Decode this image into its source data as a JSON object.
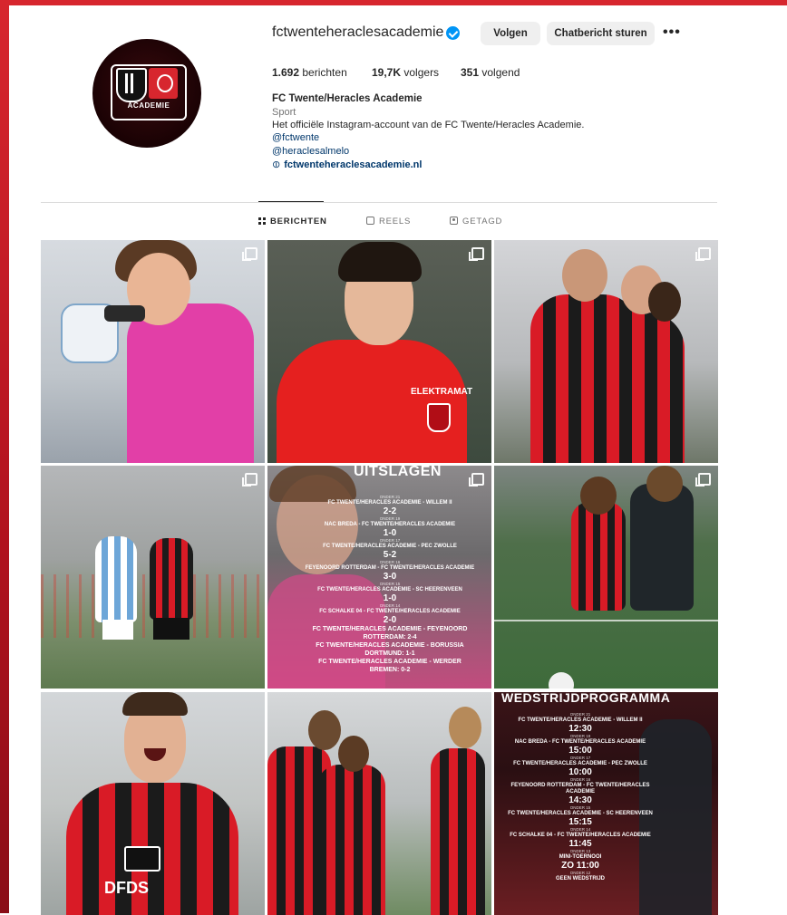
{
  "profile": {
    "username": "fctwenteheraclesacademie",
    "follow_label": "Volgen",
    "message_label": "Chatbericht sturen",
    "more_label": "•••",
    "avatar_text": "ACADEMIE",
    "stats": {
      "posts_count": "1.692",
      "posts_label": "berichten",
      "followers_count": "19,7K",
      "followers_label": "volgers",
      "following_count": "351",
      "following_label": "volgend"
    },
    "display_name": "FC Twente/Heracles Academie",
    "category": "Sport",
    "bio": "Het officiële Instagram-account van de FC Twente/Heracles Academie.",
    "mentions": [
      "@fctwente",
      "@heraclesalmelo"
    ],
    "website": "fctwenteheraclesacademie.nl"
  },
  "tabs": [
    {
      "label": "BERICHTEN",
      "active": true
    },
    {
      "label": "REELS",
      "active": false
    },
    {
      "label": "GETAGD",
      "active": false
    }
  ],
  "posts": [
    {
      "sponsor": ""
    },
    {
      "sponsor": "ELEKTRAMAT"
    },
    {
      "sponsor": ""
    },
    {
      "sponsor": ""
    },
    {
      "title": "UITSLAGEN",
      "results": [
        {
          "match": "FC TWENTE/HERACLES ACADEMIE - WILLEM II",
          "score": "2-2",
          "category": "ONDER 21"
        },
        {
          "match": "NAC BREDA - FC TWENTE/HERACLES ACADEMIE",
          "score": "1-0",
          "category": "ONDER 19"
        },
        {
          "match": "FC TWENTE/HERACLES ACADEMIE - PEC ZWOLLE",
          "score": "5-2",
          "category": "ONDER 17"
        },
        {
          "match": "FEYENOORD ROTTERDAM - FC TWENTE/HERACLES ACADEMIE",
          "score": "3-0",
          "category": "ONDER 16"
        },
        {
          "match": "FC TWENTE/HERACLES ACADEMIE - SC HEERENVEEN",
          "score": "1-0",
          "category": "ONDER 15"
        },
        {
          "match": "FC SCHALKE 04 - FC TWENTE/HERACLES ACADEMIE",
          "score": "2-0",
          "category": "ONDER 14"
        }
      ],
      "extra_results": [
        "FC TWENTE/HERACLES ACADEMIE - FEYENOORD ROTTERDAM: 2-4",
        "FC TWENTE/HERACLES ACADEMIE - BORUSSIA DORTMUND: 1-1",
        "FC TWENTE/HERACLES ACADEMIE - WERDER BREMEN: 0-2"
      ]
    },
    {
      "sponsor": ""
    },
    {
      "sponsor": "DFDS"
    },
    {
      "sponsor": ""
    },
    {
      "title": "WEDSTRIJDPROGRAMMA",
      "fixtures": [
        {
          "category": "ONDER 21",
          "match": "FC TWENTE/HERACLES ACADEMIE - WILLEM II",
          "time": "12:30"
        },
        {
          "category": "ONDER 19",
          "match": "NAC BREDA - FC TWENTE/HERACLES ACADEMIE",
          "time": "15:00"
        },
        {
          "category": "ONDER 17",
          "match": "FC TWENTE/HERACLES ACADEMIE - PEC ZWOLLE",
          "time": "10:00"
        },
        {
          "category": "ONDER 16",
          "match": "FEYENOORD ROTTERDAM - FC TWENTE/HERACLES ACADEMIE",
          "time": "14:30"
        },
        {
          "category": "ONDER 15",
          "match": "FC TWENTE/HERACLES ACADEMIE - SC HEERENVEEN",
          "time": "15:15"
        },
        {
          "category": "ONDER 14",
          "match": "FC SCHALKE 04 - FC TWENTE/HERACLES ACADEMIE",
          "time": "11:45"
        },
        {
          "category": "ONDER 13",
          "match": "MINI-TOERNOOI",
          "time": "ZO 11:00"
        },
        {
          "category": "ONDER 12",
          "match": "GEEN WEDSTRIJD",
          "time": ""
        }
      ]
    }
  ],
  "colors": {
    "brand_red": "#d7262e",
    "verified_blue": "#0095f6",
    "link_blue": "#00376b"
  }
}
